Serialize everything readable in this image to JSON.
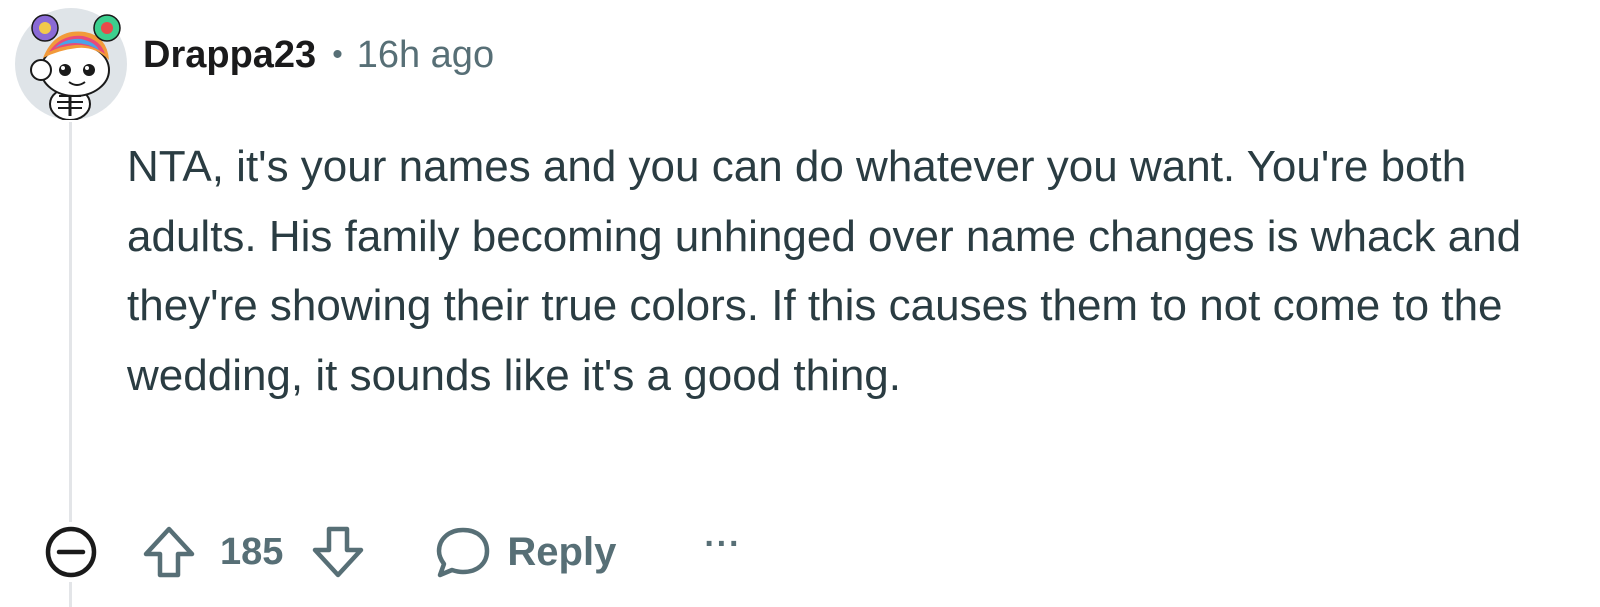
{
  "comment": {
    "author": "Drappa23",
    "separator": "•",
    "timestamp": "16h ago",
    "body": "NTA, it's your names and you can do whatever you want. You're both adults. His family becoming unhinged over name changes is whack and they're showing their true colors. If this causes them to not come to the wedding, it sounds like it's a good thing."
  },
  "actions": {
    "score": "185",
    "reply_label": "Reply",
    "more_label": "···"
  },
  "icons": {
    "collapse": "collapse-minus-circle-icon",
    "upvote": "arrow-up-outline-icon",
    "downvote": "arrow-down-outline-icon",
    "reply": "speech-bubble-icon",
    "more": "ellipsis-icon"
  },
  "colors": {
    "meta_gray": "#576f76",
    "body_text": "#2a3c42",
    "thread_line": "#e3e5e8",
    "avatar_bg": "#dfe4e8"
  }
}
